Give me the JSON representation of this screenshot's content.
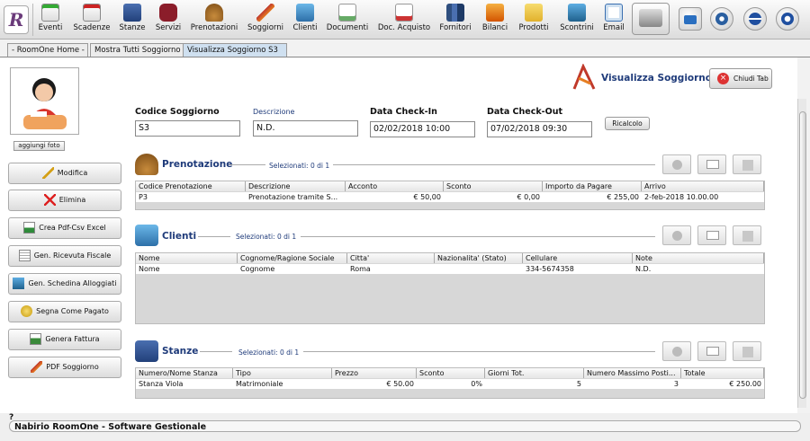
{
  "toolbar": {
    "items": [
      {
        "label": "Eventi",
        "icon": "calendar-add-icon"
      },
      {
        "label": "Scadenze",
        "icon": "calendar-remove-icon"
      },
      {
        "label": "Stanze",
        "icon": "bed-icon"
      },
      {
        "label": "Servizi",
        "icon": "shirt-icon"
      },
      {
        "label": "Prenotazioni",
        "icon": "bell-icon"
      },
      {
        "label": "Soggiorni",
        "icon": "soggiorno-icon"
      },
      {
        "label": "Clienti",
        "icon": "clients-icon"
      },
      {
        "label": "Documenti",
        "icon": "document-icon"
      },
      {
        "label": "Doc. Acquisto",
        "icon": "purchase-doc-icon"
      },
      {
        "label": "Fornitori",
        "icon": "suppliers-icon"
      },
      {
        "label": "Bilanci",
        "icon": "balance-icon"
      },
      {
        "label": "Prodotti",
        "icon": "products-icon"
      },
      {
        "label": "Scontrini",
        "icon": "receipt-icon"
      },
      {
        "label": "Email",
        "icon": "email-icon"
      }
    ],
    "right_icons": [
      "cash-register-icon",
      "keyboard-icon",
      "settings-icon",
      "minimize-icon",
      "power-icon"
    ]
  },
  "tabs": [
    "- RoomOne Home -",
    "Mostra Tutti Soggiorno",
    "Visualizza Soggiorno S3"
  ],
  "header": {
    "title": "Visualizza Soggiorno",
    "close_label": "Chiudi Tab"
  },
  "sidebar": {
    "add_photo": "aggiungi foto",
    "buttons": [
      "Modifica",
      "Elimina",
      "Crea Pdf-Csv Excel",
      "Gen. Ricevuta Fiscale",
      "Gen. Schedina Alloggiati",
      "Segna Come Pagato",
      "Genera Fattura",
      "PDF Soggiorno"
    ]
  },
  "form": {
    "codice_label": "Codice Soggiorno",
    "codice_value": "S3",
    "descrizione_label": "Descrizione",
    "descrizione_value": "N.D.",
    "checkin_label": "Data Check-In",
    "checkin_value": "02/02/2018 10:00",
    "checkout_label": "Data Check-Out",
    "checkout_value": "07/02/2018 09:30",
    "ricalcolo_label": "Ricalcolo"
  },
  "prenotazione": {
    "title": "Prenotazione",
    "selected": "Selezionati:  0 di 1",
    "columns": [
      "Codice Prenotazione",
      "Descrizione",
      "Acconto",
      "Sconto",
      "Importo da Pagare",
      "Arrivo"
    ],
    "rows": [
      [
        "P3",
        "Prenotazione tramite S...",
        "€ 50,00",
        "€ 0,00",
        "€ 255,00",
        "2-feb-2018 10.00.00"
      ]
    ]
  },
  "clienti": {
    "title": "Clienti",
    "selected": "Selezionati:  0 di 1",
    "columns": [
      "Nome",
      "Cognome/Ragione Sociale",
      "Citta'",
      "Nazionalita' (Stato)",
      "Cellulare",
      "Note"
    ],
    "rows": [
      [
        "Nome",
        "Cognome",
        "Roma",
        "",
        "334-5674358",
        "N.D."
      ]
    ]
  },
  "stanze": {
    "title": "Stanze",
    "selected": "Selezionati:  0 di 1",
    "columns": [
      "Numero/Nome Stanza",
      "Tipo",
      "Prezzo",
      "Sconto",
      "Giorni Tot.",
      "Numero Massimo Posti...",
      "Totale"
    ],
    "rows": [
      [
        "Stanza Viola",
        "Matrimoniale",
        "€ 50.00",
        "0%",
        "5",
        "3",
        "€ 250.00"
      ]
    ]
  },
  "status": {
    "help": "?",
    "text": "Nabirio RoomOne - Software Gestionale"
  },
  "colors": {
    "accent": "#1f3b7a",
    "tab_active": "#cfe0f0"
  }
}
